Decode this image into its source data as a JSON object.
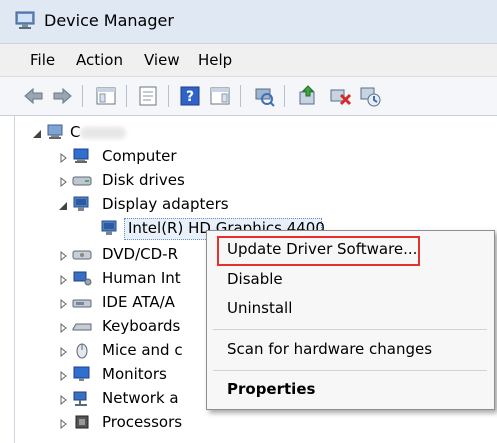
{
  "window": {
    "title": "Device Manager"
  },
  "menu": [
    "File",
    "Action",
    "View",
    "Help"
  ],
  "toolbar_icons": [
    "back-arrow-icon",
    "forward-arrow-icon",
    "show-hide-console-tree-icon",
    "properties-icon",
    "help-icon",
    "view-icon",
    "scan-hardware-icon",
    "update-driver-icon",
    "uninstall-icon",
    "disable-icon"
  ],
  "tree": {
    "root_label": "C",
    "items": [
      {
        "label": "Computer",
        "icon": "computer-icon",
        "expanded": false
      },
      {
        "label": "Disk drives",
        "icon": "disk-drive-icon",
        "expanded": false
      },
      {
        "label": "Display adapters",
        "icon": "display-adapter-icon",
        "expanded": true
      },
      {
        "label": "Intel(R) HD Graphics 4400",
        "icon": "display-adapter-icon",
        "child": true,
        "selected": true
      },
      {
        "label": "DVD/CD-R",
        "icon": "dvd-drive-icon",
        "expanded": false
      },
      {
        "label": "Human Int",
        "icon": "hid-icon",
        "expanded": false
      },
      {
        "label": "IDE ATA/A",
        "icon": "ide-controller-icon",
        "expanded": false
      },
      {
        "label": "Keyboards",
        "icon": "keyboard-icon",
        "expanded": false
      },
      {
        "label": "Mice and c",
        "icon": "mouse-icon",
        "expanded": false
      },
      {
        "label": "Monitors",
        "icon": "monitor-icon",
        "expanded": false
      },
      {
        "label": "Network a",
        "icon": "network-adapter-icon",
        "expanded": false
      },
      {
        "label": "Processors",
        "icon": "processor-icon",
        "expanded": false
      }
    ]
  },
  "context_menu": {
    "items": [
      "Update Driver Software...",
      "Disable",
      "Uninstall",
      "Scan for hardware changes",
      "Properties"
    ],
    "highlight_color": "#e53030"
  }
}
